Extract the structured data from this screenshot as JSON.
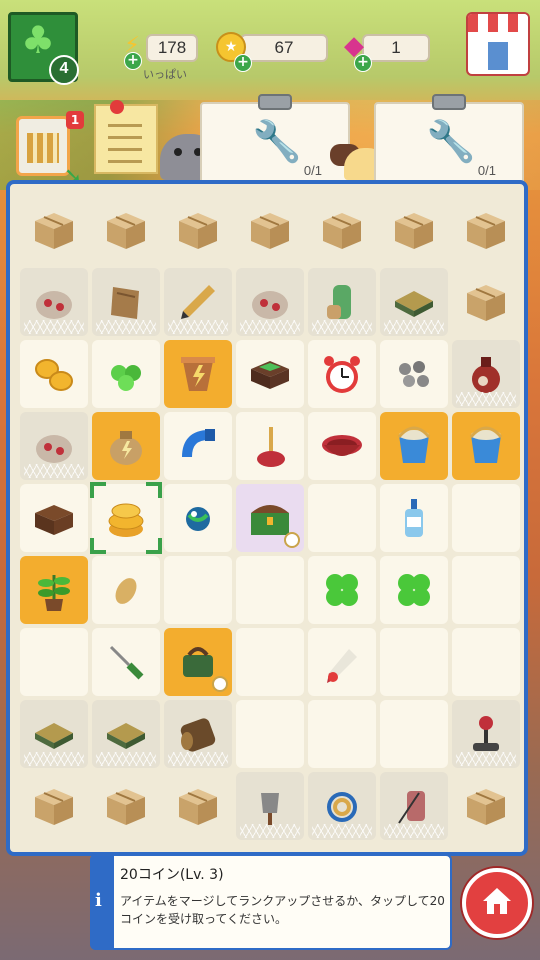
{
  "top_bar": {
    "level": "4",
    "energy": {
      "value": "178",
      "status": "いっぱい"
    },
    "coins": {
      "value": "67"
    },
    "gems": {
      "value": "1"
    }
  },
  "events": {
    "notification_count": "1"
  },
  "orders": [
    {
      "item": "pipe-wrench",
      "progress": "0/1"
    },
    {
      "item": "adjustable-wrench",
      "progress": "0/1"
    }
  ],
  "board": {
    "rows": 9,
    "cols": 7,
    "cells": [
      [
        "box",
        "box",
        "box",
        "box",
        "box",
        "box",
        "box"
      ],
      [
        "pouch-web",
        "plank-web",
        "pencil-web",
        "pouch-web",
        "thermos-web",
        "tarp-web",
        "box"
      ],
      [
        "coins",
        "green-blobs",
        "pot-gold",
        "cash-box",
        "alarm-clock",
        "dumbbells",
        "flask-web"
      ],
      [
        "pouch-web",
        "sack-gold",
        "blue-pipe",
        "plunger",
        "basin",
        "bucket-gold",
        "bucket-gold"
      ],
      [
        "crate",
        "coin-stack-selected",
        "marble",
        "chest-timer",
        "empty",
        "soap-bottle",
        "empty"
      ],
      [
        "plant-gold",
        "seed",
        "empty",
        "empty",
        "clover",
        "clover",
        "empty"
      ],
      [
        "empty",
        "screwdriver",
        "bag-timer-gold",
        "empty",
        "paint-tube",
        "empty",
        "empty"
      ],
      [
        "tarp-web",
        "tarp-web",
        "log-web",
        "empty",
        "empty",
        "empty",
        "joystick-web"
      ],
      [
        "box",
        "box",
        "box",
        "shovel-web",
        "rope-web",
        "thread-web",
        "box"
      ]
    ]
  },
  "info_panel": {
    "title": "20コイン(Lv. 3)",
    "description": "アイテムをマージしてランクアップさせるか、タップして20コインを受け取ってください。",
    "info_icon": "i"
  },
  "colors": {
    "board_border": "#2f6bc6",
    "gold_cell": "#f3ad2e",
    "select": "#3aa14a"
  }
}
